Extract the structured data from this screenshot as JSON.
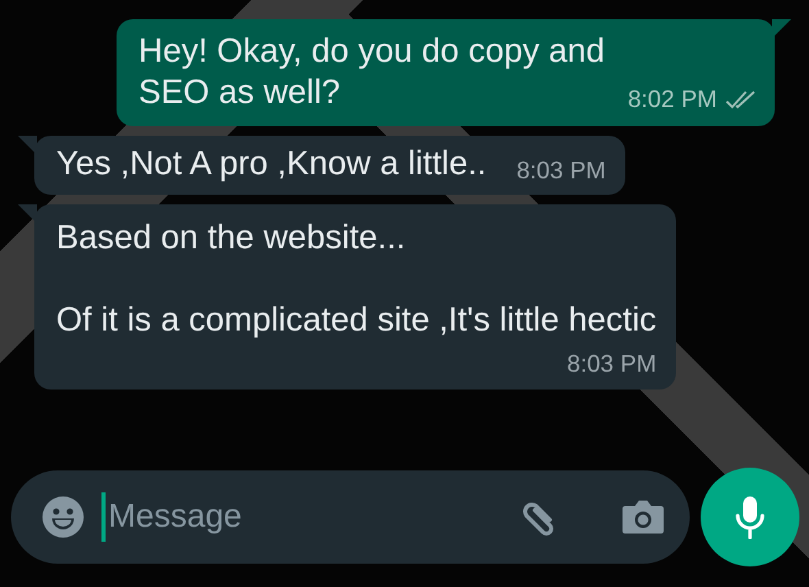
{
  "messages": [
    {
      "kind": "outgoing",
      "paragraphs": [
        "Hey! Okay, do you do copy and SEO as well?"
      ],
      "time": "8:02 PM",
      "read": false,
      "inline_time": true
    },
    {
      "kind": "incoming",
      "paragraphs": [
        "Yes ,Not A pro ,Know a little.."
      ],
      "time": "8:03 PM",
      "inline_time": true
    },
    {
      "kind": "incoming",
      "paragraphs": [
        "Based on the website...",
        "Of it is a complicated site ,It's little hectic"
      ],
      "time": "8:03 PM",
      "inline_time": false
    }
  ],
  "composer": {
    "placeholder": "Message"
  }
}
